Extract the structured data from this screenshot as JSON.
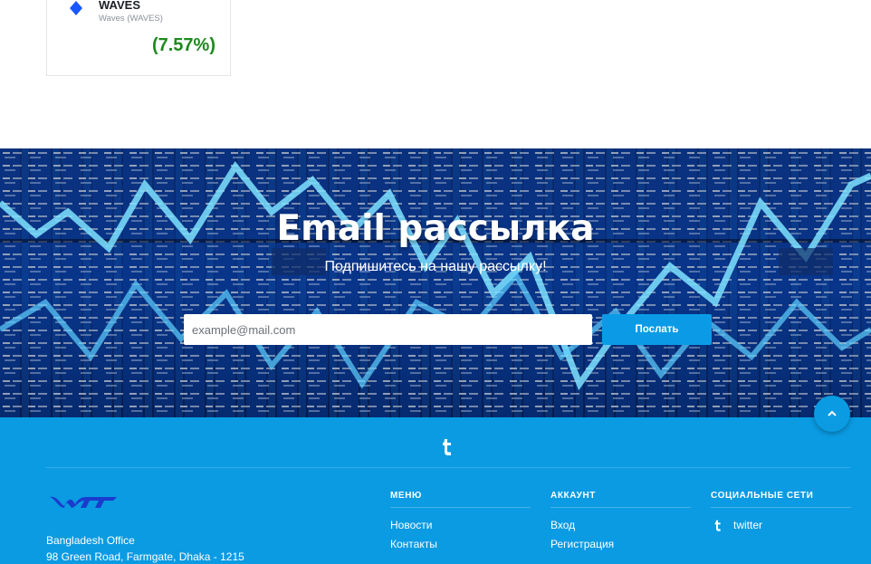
{
  "coin_card": {
    "symbol": "WAVES",
    "name": "Waves (WAVES)",
    "change": "(7.57%)",
    "icon": "diamond-icon",
    "change_color": "#1d8a1d"
  },
  "newsletter": {
    "title": "Email рассылка",
    "subtitle": "Подпишитесь на нашу рассылку!",
    "input_placeholder": "example@mail.com",
    "button_label": "Послать",
    "button_color": "#0b9be6"
  },
  "footer": {
    "background": "#0a9be3",
    "top_social_icon": "tumblr-icon",
    "logo_icon": "wtt-logo",
    "office_title": "Bangladesh Office",
    "office_address": "98 Green Road, Farmgate, Dhaka - 1215",
    "columns": [
      {
        "heading": "МЕНЮ",
        "links": [
          "Новости",
          "Контакты"
        ]
      },
      {
        "heading": "АККАУНТ",
        "links": [
          "Вход",
          "Регистрация"
        ]
      },
      {
        "heading": "СОЦИАЛЬНЫЕ СЕТИ",
        "links": [
          "twitter"
        ],
        "link_icon": "tumblr-icon"
      }
    ]
  },
  "back_to_top_icon": "chevron-up-icon"
}
